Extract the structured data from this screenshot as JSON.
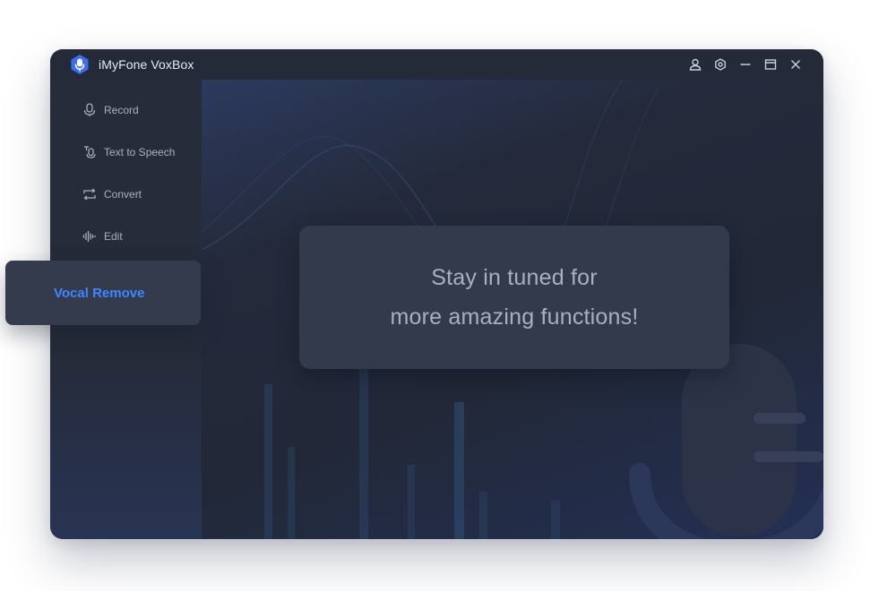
{
  "app": {
    "title": "iMyFone VoxBox"
  },
  "window_controls": {
    "icons": [
      "user-icon",
      "settings-icon",
      "minimize-icon",
      "maximize-icon",
      "close-icon"
    ]
  },
  "sidebar": {
    "items": [
      {
        "label": "Record",
        "icon": "microphone-icon"
      },
      {
        "label": "Text to Speech",
        "icon": "tts-icon"
      },
      {
        "label": "Convert",
        "icon": "convert-icon"
      },
      {
        "label": "Edit",
        "icon": "waveform-icon"
      }
    ],
    "active_item": {
      "label": "Vocal Remove"
    }
  },
  "main": {
    "message_line1": "Stay in tuned for",
    "message_line2": "more amazing functions!"
  },
  "colors": {
    "accent": "#3f86ff",
    "window_bg": "#262b39",
    "card_bg": "#333a4c"
  }
}
